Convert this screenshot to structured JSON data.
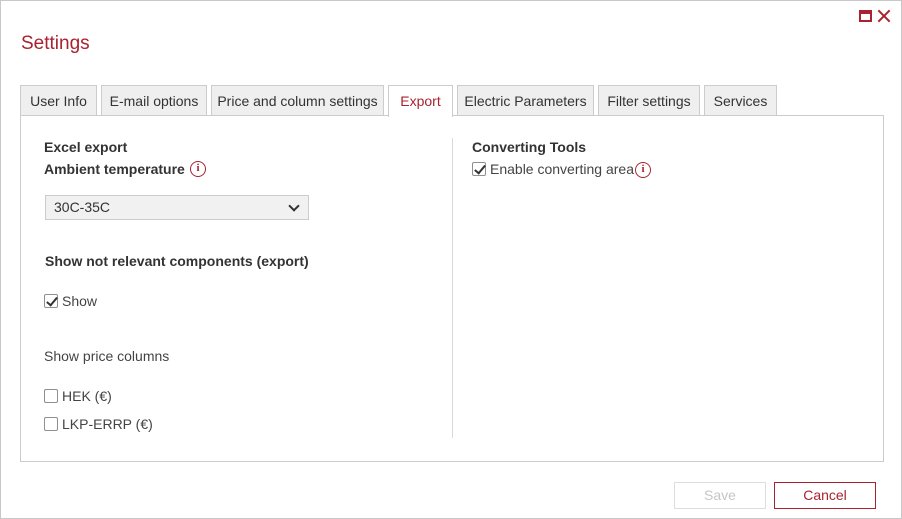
{
  "dialog": {
    "title": "Settings"
  },
  "tabs": [
    {
      "label": "User Info"
    },
    {
      "label": "E-mail options"
    },
    {
      "label": "Price and column settings"
    },
    {
      "label": "Export",
      "active": true
    },
    {
      "label": "Electric Parameters"
    },
    {
      "label": "Filter settings"
    },
    {
      "label": "Services"
    }
  ],
  "export": {
    "excel_export_label": "Excel export",
    "ambient_temperature_label": "Ambient temperature",
    "ambient_temperature_value": "30C-35C",
    "not_relevant_label": "Show not relevant components (export)",
    "show_label": "Show",
    "show_checked": true,
    "price_columns_label": "Show price columns",
    "price_columns": [
      {
        "label": "HEK (€)",
        "checked": false
      },
      {
        "label": "LKP-ERRP (€)",
        "checked": false
      }
    ]
  },
  "converting": {
    "header": "Converting Tools",
    "enable_label": "Enable converting area",
    "enable_checked": true
  },
  "buttons": {
    "save": "Save",
    "cancel": "Cancel"
  },
  "info_glyph": "i",
  "colors": {
    "accent": "#a8232f",
    "tab_inactive_bg": "#efefef",
    "border": "#cccccc"
  }
}
